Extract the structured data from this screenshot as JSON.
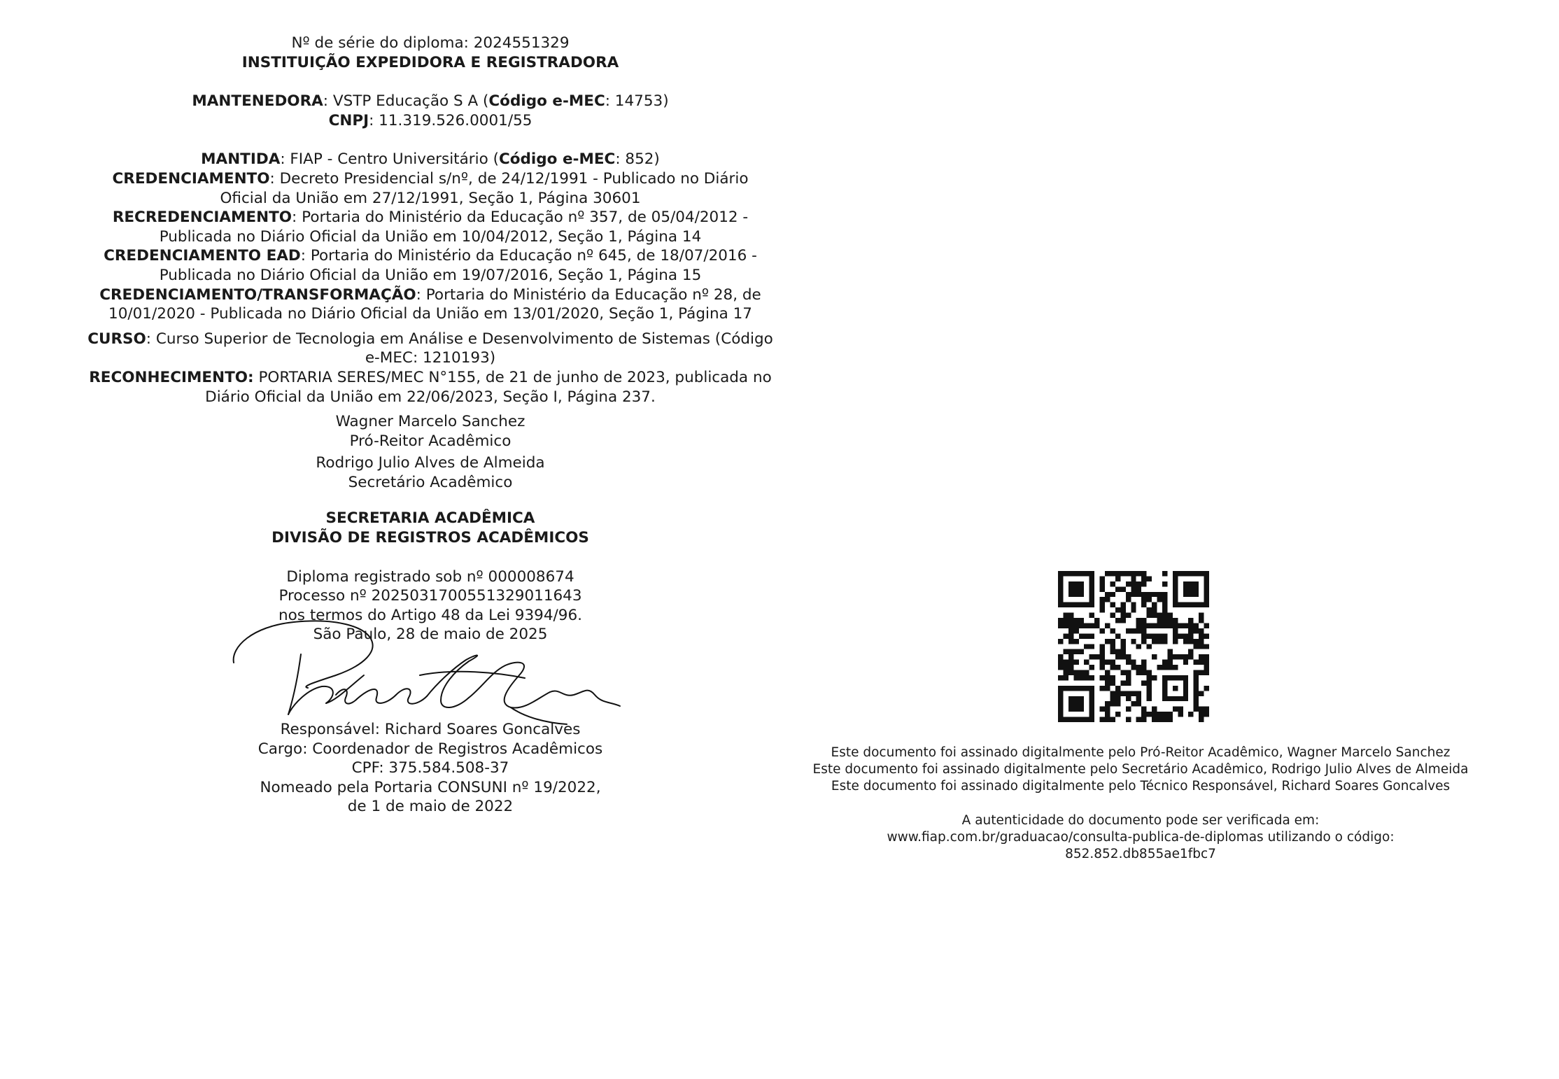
{
  "header": {
    "serial": "Nº de série do diploma: 2024551329",
    "title": "INSTITUIÇÃO EXPEDIDORA E REGISTRADORA"
  },
  "mantenedora": {
    "label": "MANTENEDORA",
    "text_a": ": VSTP Educação S A (",
    "code_label": "Código e-MEC",
    "text_b": ": 14753)",
    "cnpj_label": "CNPJ",
    "cnpj_text": ": 11.319.526.0001/55"
  },
  "mantida": {
    "label": "MANTIDA",
    "text_a": ": FIAP - Centro Universitário (",
    "code_label": "Código e-MEC",
    "text_b": ": 852)"
  },
  "credenciamento": {
    "label": "CREDENCIAMENTO",
    "line1": ": Decreto Presidencial s/nº, de 24/12/1991 - Publicado no Diário",
    "line2": "Oficial da União em 27/12/1991, Seção 1, Página 30601"
  },
  "recredenciamento": {
    "label": "RECREDENCIAMENTO",
    "line1": ": Portaria do Ministério da Educação nº 357, de 05/04/2012 -",
    "line2": "Publicada no Diário Oficial da União em 10/04/2012, Seção 1, Página 14"
  },
  "credenciamento_ead": {
    "label": "CREDENCIAMENTO EAD",
    "line1": ": Portaria do Ministério da Educação nº 645, de 18/07/2016 -",
    "line2": "Publicada no Diário Oficial da União em 19/07/2016, Seção 1, Página 15"
  },
  "transformacao": {
    "label": "CREDENCIAMENTO/TRANSFORMAÇÃO",
    "line1": ": Portaria do Ministério da Educação nº 28, de",
    "line2": "10/01/2020 - Publicada no Diário Oficial da União em 13/01/2020, Seção 1, Página 17"
  },
  "curso": {
    "label": "CURSO",
    "line1": ": Curso Superior de Tecnologia em Análise e Desenvolvimento de Sistemas (Código",
    "line2": "e-MEC: 1210193)"
  },
  "reconhecimento": {
    "label": "RECONHECIMENTO:",
    "line1": " PORTARIA SERES/MEC N°155, de 21 de junho de 2023, publicada no",
    "line2": "Diário Oficial da União em 22/06/2023, Seção I, Página 237."
  },
  "signatories": [
    {
      "name": "Wagner Marcelo Sanchez",
      "role": "Pró-Reitor Acadêmico"
    },
    {
      "name": "Rodrigo Julio Alves de Almeida",
      "role": "Secretário Acadêmico"
    }
  ],
  "secretaria": {
    "line1": "SECRETARIA ACADÊMICA",
    "line2": "DIVISÃO DE REGISTROS ACADÊMICOS"
  },
  "registro": {
    "line1": "Diploma registrado sob nº 000008674",
    "line2": "Processo nº 20250317005513290116​43",
    "line3": "nos termos do Artigo 48 da Lei 9394/96.",
    "line4": "São Paulo, 28 de maio de 2025"
  },
  "signature": {
    "handwritten_text": "Richard Soares"
  },
  "responsavel": {
    "line1": "Responsável: Richard Soares Goncalves",
    "line2": "Cargo: Coordenador de Registros Acadêmicos",
    "line3": "CPF: 375.584.508-37",
    "line4": "Nomeado pela Portaria CONSUNI nº 19/2022,",
    "line5": "de 1 de maio de 2022"
  },
  "digital_signatures": {
    "line1": "Este documento foi assinado digitalmente pelo Pró-Reitor Acadêmico, Wagner Marcelo Sanchez",
    "line2": "Este documento foi assinado digitalmente pelo Secretário Acadêmico, Rodrigo Julio Alves de Almeida",
    "line3": "Este documento foi assinado digitalmente pelo Técnico Responsável, Richard Soares Goncalves"
  },
  "verification": {
    "line1": "A autenticidade do documento pode ser verificada em:",
    "line2": "www.fiap.com.br/graduacao/consulta-publica-de-diplomas utilizando o código:",
    "line3": "852.852.db855ae1fbc7"
  },
  "qr": {
    "icon": "qr-code-icon"
  }
}
